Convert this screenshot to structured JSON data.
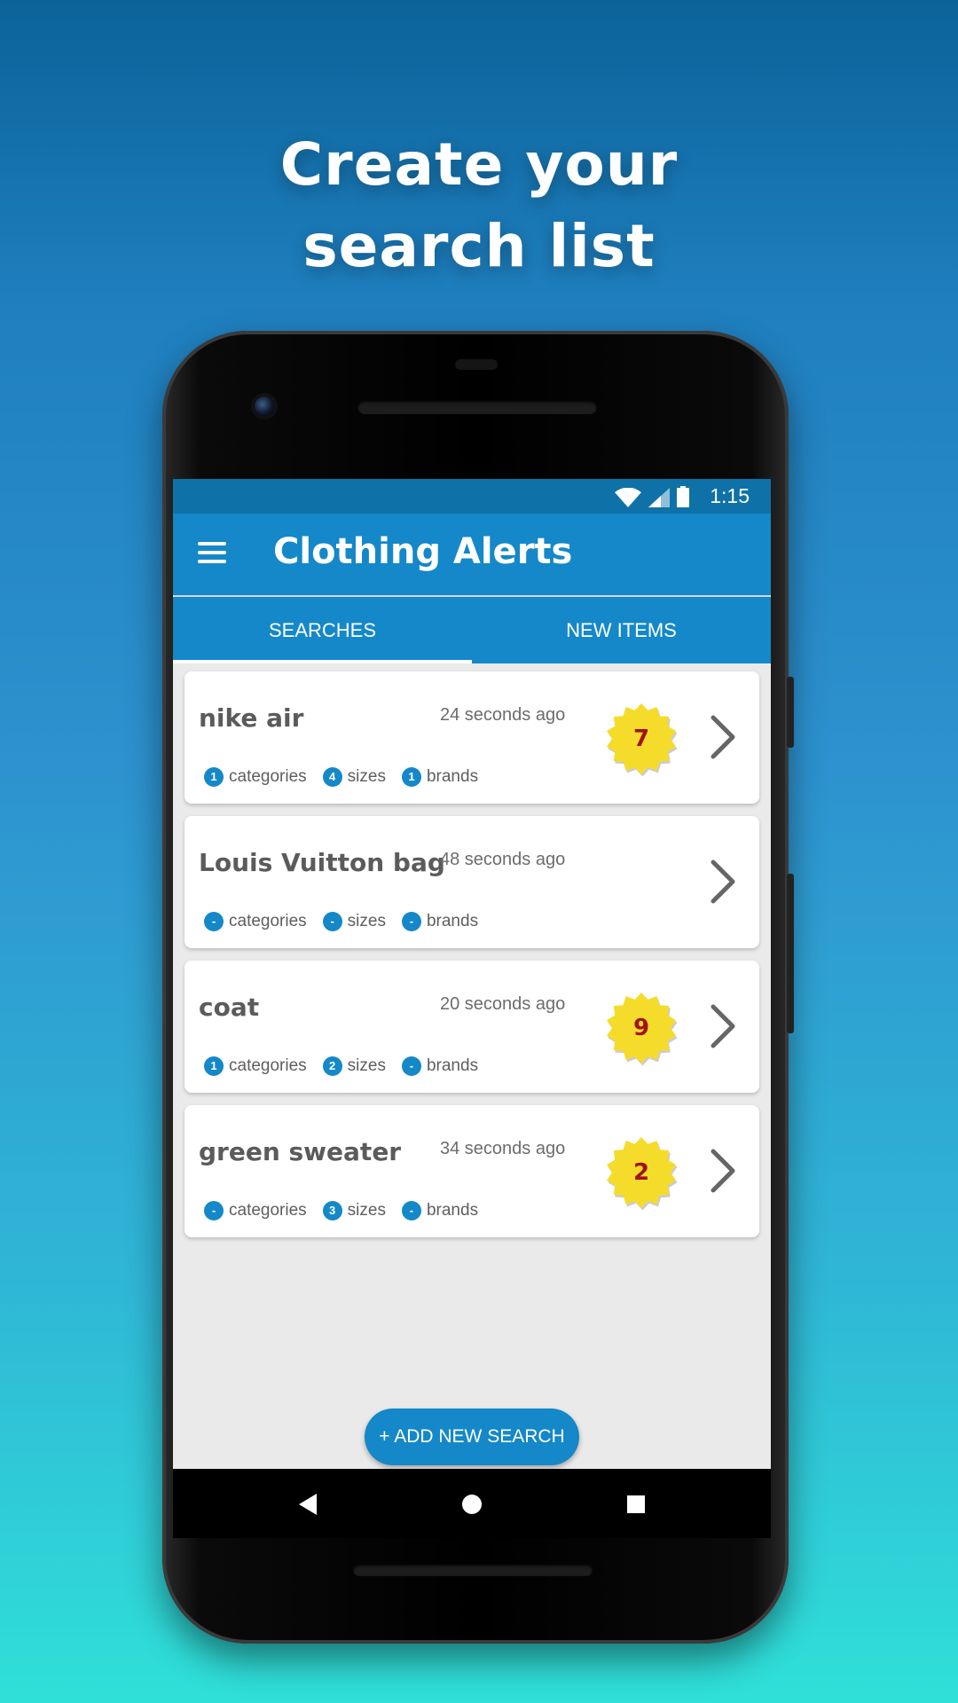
{
  "headline": {
    "line1": "Create your",
    "line2": "search list"
  },
  "status_bar": {
    "time": "1:15",
    "icons": [
      "wifi-icon",
      "signal-icon",
      "battery-icon"
    ]
  },
  "app_bar": {
    "title": "Clothing Alerts",
    "menu_icon": "menu-icon"
  },
  "tabs": [
    {
      "label": "SEARCHES",
      "selected": true
    },
    {
      "label": "NEW ITEMS",
      "selected": false
    }
  ],
  "searches": [
    {
      "title": "nike air",
      "time": "24 seconds ago",
      "categories_count": "1",
      "sizes_count": "4",
      "brands_count": "1",
      "categories_label": "categories",
      "sizes_label": "sizes",
      "brands_label": "brands",
      "new_items": "7"
    },
    {
      "title": "Louis Vuitton bag",
      "time": "48 seconds ago",
      "categories_count": "-",
      "sizes_count": "-",
      "brands_count": "-",
      "categories_label": "categories",
      "sizes_label": "sizes",
      "brands_label": "brands",
      "new_items": ""
    },
    {
      "title": "coat",
      "time": "20 seconds ago",
      "categories_count": "1",
      "sizes_count": "2",
      "brands_count": "-",
      "categories_label": "categories",
      "sizes_label": "sizes",
      "brands_label": "brands",
      "new_items": "9"
    },
    {
      "title": "green sweater",
      "time": "34 seconds ago",
      "categories_count": "-",
      "sizes_count": "3",
      "brands_count": "-",
      "categories_label": "categories",
      "sizes_label": "sizes",
      "brands_label": "brands",
      "new_items": "2"
    }
  ],
  "fab": {
    "label": "+ ADD NEW SEARCH"
  },
  "nav_bar": {
    "icons": [
      "back-icon",
      "home-icon",
      "recents-icon"
    ]
  },
  "colors": {
    "primary": "#1488c8",
    "status_bar": "#0e72a8",
    "badge": "#f5dc2a",
    "badge_text": "#a3121b"
  }
}
